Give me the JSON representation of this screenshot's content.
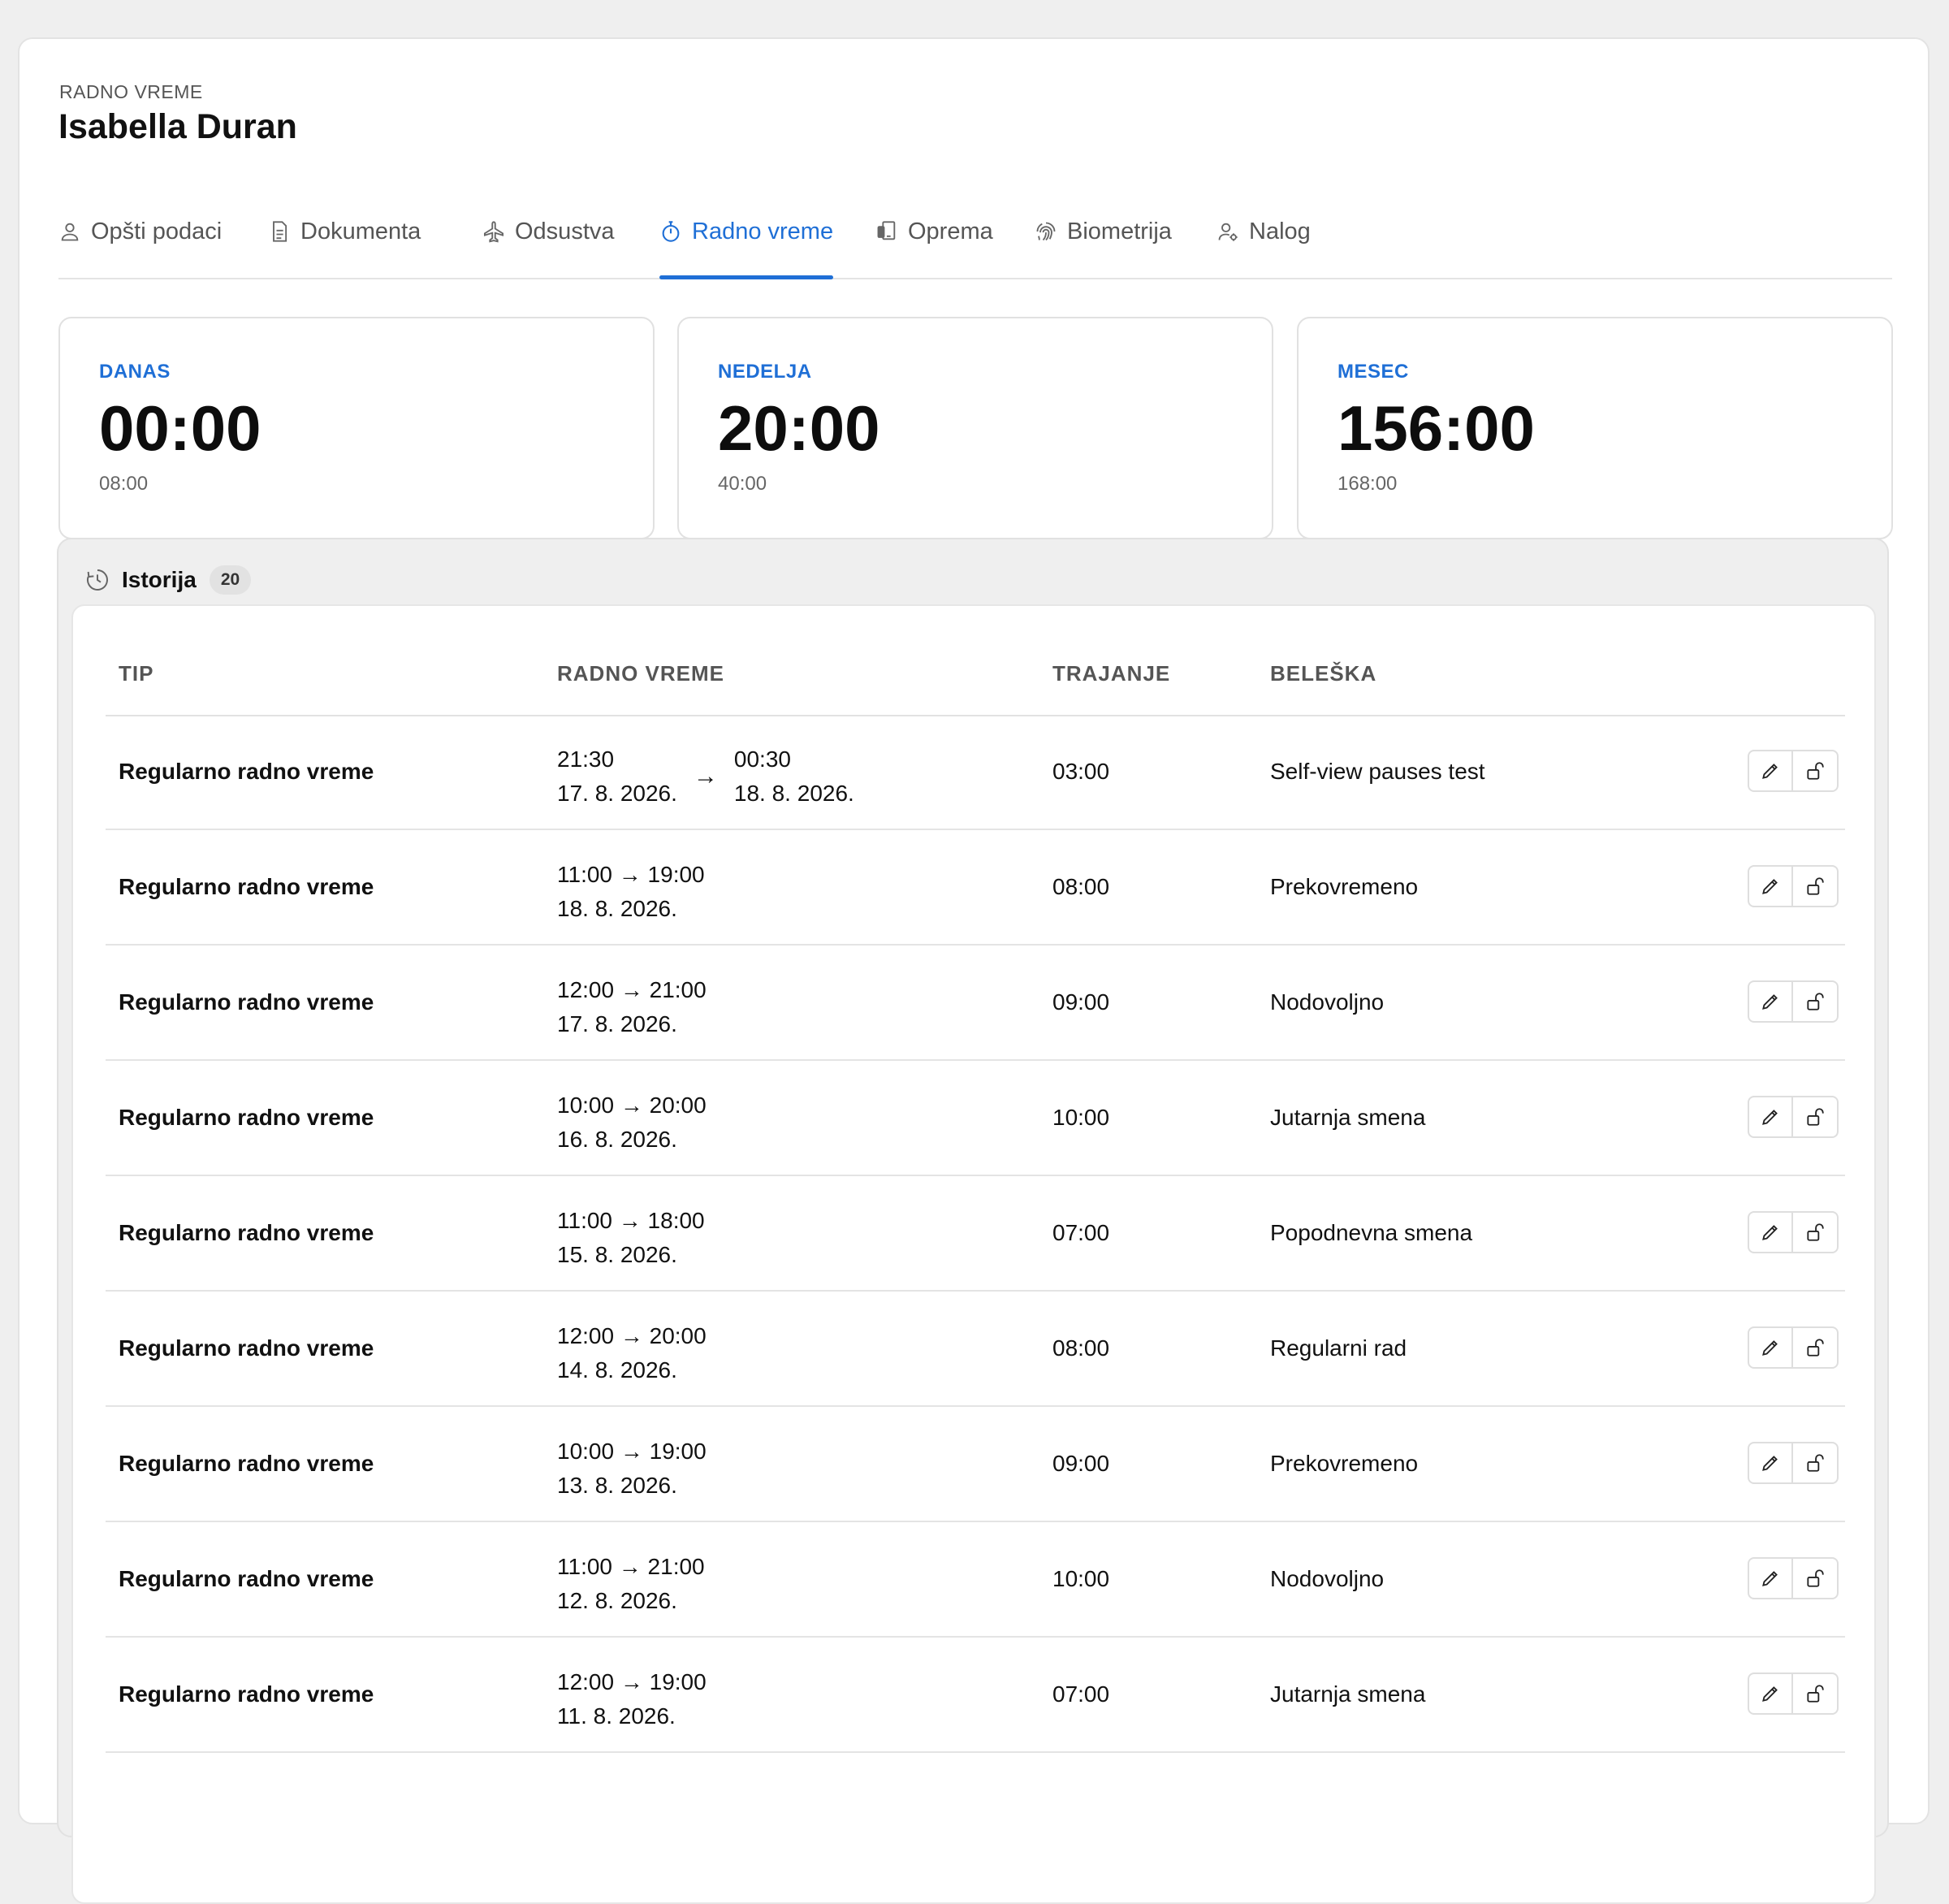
{
  "header": {
    "eyebrow": "RADNO VREME",
    "title": "Isabella Duran"
  },
  "tabs": [
    {
      "label": "Opšti podaci",
      "icon": "user-icon",
      "active": false
    },
    {
      "label": "Dokumenta",
      "icon": "document-icon",
      "active": false
    },
    {
      "label": "Odsustva",
      "icon": "airplane-icon",
      "active": false
    },
    {
      "label": "Radno vreme",
      "icon": "stopwatch-icon",
      "active": true
    },
    {
      "label": "Oprema",
      "icon": "devices-icon",
      "active": false
    },
    {
      "label": "Biometrija",
      "icon": "fingerprint-icon",
      "active": false
    },
    {
      "label": "Nalog",
      "icon": "user-settings-icon",
      "active": false
    }
  ],
  "stats": [
    {
      "label": "DANAS",
      "value": "00:00",
      "target": "08:00"
    },
    {
      "label": "NEDELJA",
      "value": "20:00",
      "target": "40:00"
    },
    {
      "label": "MESEC",
      "value": "156:00",
      "target": "168:00"
    }
  ],
  "history": {
    "title": "Istorija",
    "count": "20",
    "columns": [
      "TIP",
      "RADNO VREME",
      "TRAJANJE",
      "BELEŠKA"
    ],
    "rows": [
      {
        "type": "Regularno radno vreme",
        "start": "21:30",
        "end": "00:30",
        "start_date": "17. 8. 2026.",
        "end_date": "18. 8. 2026.",
        "duration": "03:00",
        "note": "Self-view pauses test"
      },
      {
        "type": "Regularno radno vreme",
        "range": "11:00 → 19:00",
        "date": "18. 8. 2026.",
        "duration": "08:00",
        "note": "Prekovremeno"
      },
      {
        "type": "Regularno radno vreme",
        "range": "12:00 → 21:00",
        "date": "17. 8. 2026.",
        "duration": "09:00",
        "note": "Nodovoljno"
      },
      {
        "type": "Regularno radno vreme",
        "range": "10:00 → 20:00",
        "date": "16. 8. 2026.",
        "duration": "10:00",
        "note": "Jutarnja smena"
      },
      {
        "type": "Regularno radno vreme",
        "range": "11:00 → 18:00",
        "date": "15. 8. 2026.",
        "duration": "07:00",
        "note": "Popodnevna smena"
      },
      {
        "type": "Regularno radno vreme",
        "range": "12:00 → 20:00",
        "date": "14. 8. 2026.",
        "duration": "08:00",
        "note": "Regularni rad"
      },
      {
        "type": "Regularno radno vreme",
        "range": "10:00 → 19:00",
        "date": "13. 8. 2026.",
        "duration": "09:00",
        "note": "Prekovremeno"
      },
      {
        "type": "Regularno radno vreme",
        "range": "11:00 → 21:00",
        "date": "12. 8. 2026.",
        "duration": "10:00",
        "note": "Nodovoljno"
      },
      {
        "type": "Regularno radno vreme",
        "range": "12:00 → 19:00",
        "date": "11. 8. 2026.",
        "duration": "07:00",
        "note": "Jutarnja smena"
      }
    ],
    "row_actions": {
      "edit_icon": "pencil-icon",
      "unlock_icon": "unlock-icon"
    }
  },
  "colors": {
    "accent": "#1f6fd6",
    "page_bg": "#efefef",
    "border": "#e2e2e2"
  }
}
